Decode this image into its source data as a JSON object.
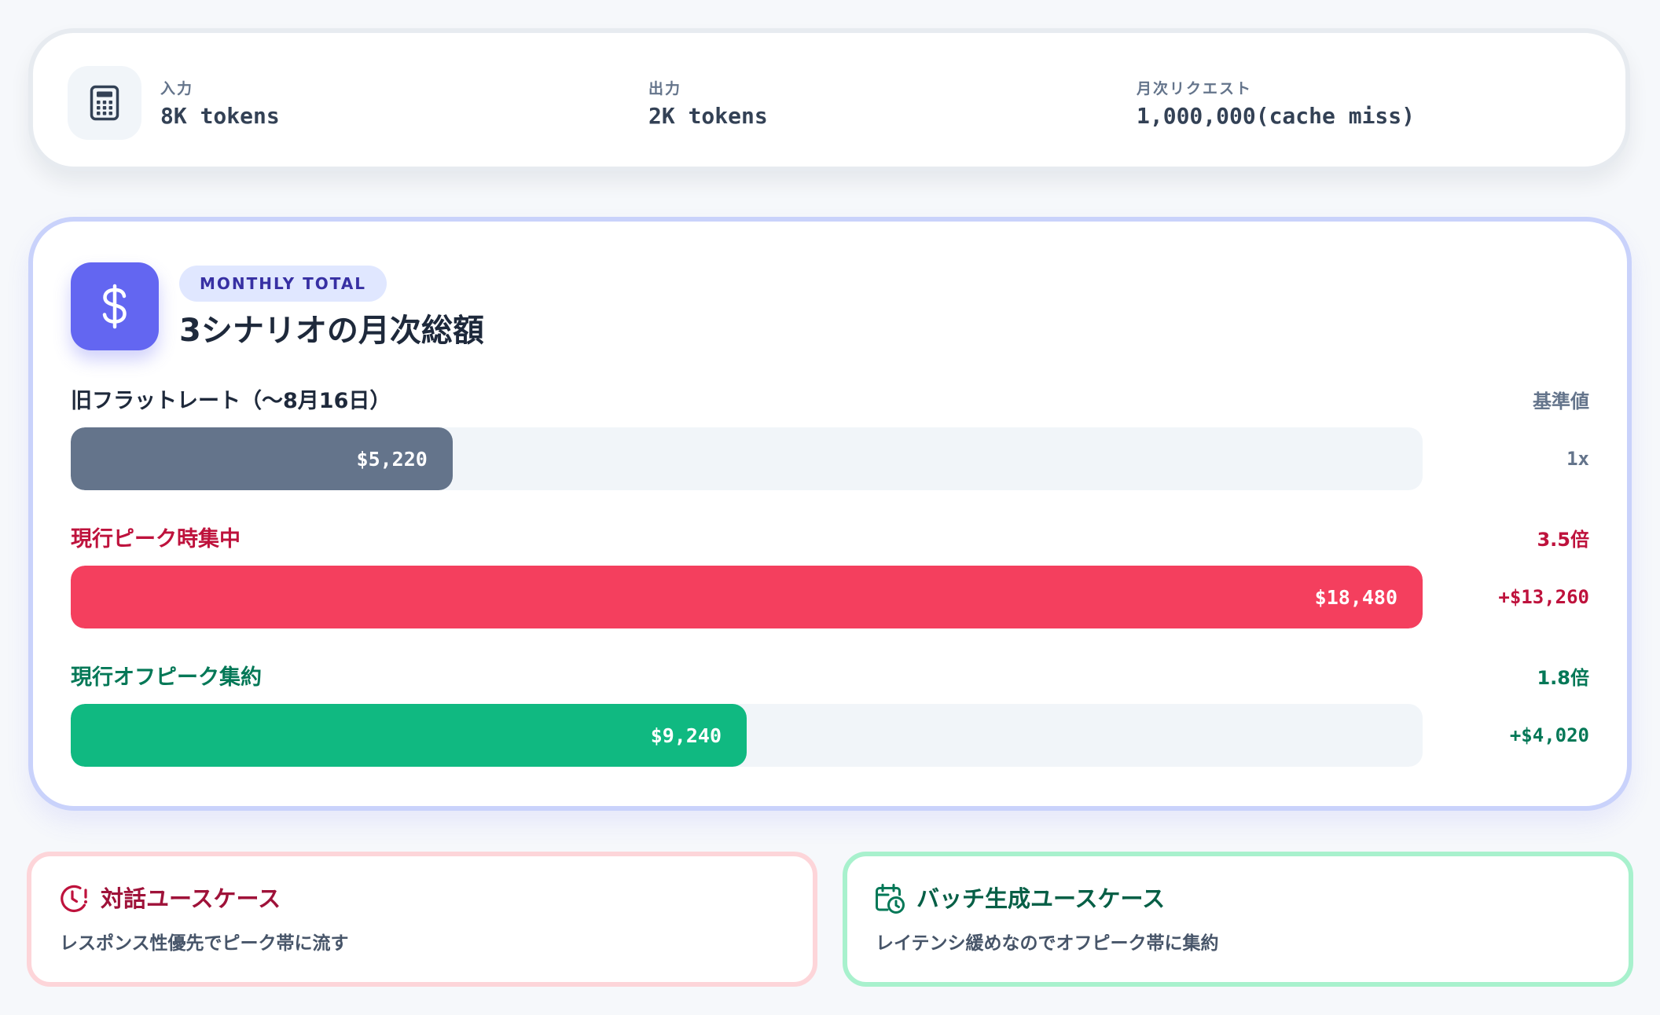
{
  "info": {
    "items": [
      {
        "label": "入力",
        "value": "8K tokens"
      },
      {
        "label": "出力",
        "value": "2K tokens"
      },
      {
        "label": "月次リクエスト",
        "value": "1,000,000(cache miss)"
      }
    ],
    "icon": "calculator-icon"
  },
  "total": {
    "badge_icon": "dollar-icon",
    "pill": "MONTHLY TOTAL",
    "title": "3シナリオの月次総額",
    "scale_max": 18480,
    "rows": [
      {
        "label": "旧フラットレート（〜8月16日）",
        "value": 5220,
        "value_label": "$5,220",
        "right_top": "基準値",
        "right_bottom": "1x",
        "color": "#64748b",
        "label_color": "#1e293b",
        "right_color": "#64748b"
      },
      {
        "label": "現行ピーク時集中",
        "value": 18480,
        "value_label": "$18,480",
        "right_top": "3.5倍",
        "right_bottom": "+$13,260",
        "color": "#f43f5e",
        "label_color": "#be123c",
        "right_color": "#be123c"
      },
      {
        "label": "現行オフピーク集約",
        "value": 9240,
        "value_label": "$9,240",
        "right_top": "1.8倍",
        "right_bottom": "+$4,020",
        "color": "#10b981",
        "label_color": "#047857",
        "right_color": "#047857"
      }
    ]
  },
  "cases": [
    {
      "title": "対話ユースケース",
      "desc": "レスポンス性優先でピーク帯に流す",
      "icon": "clock-alert-icon",
      "color": "#9f1239"
    },
    {
      "title": "バッチ生成ユースケース",
      "desc": "レイテンシ緩めなのでオフピーク帯に集約",
      "icon": "calendar-clock-icon",
      "color": "#065f46"
    }
  ]
}
